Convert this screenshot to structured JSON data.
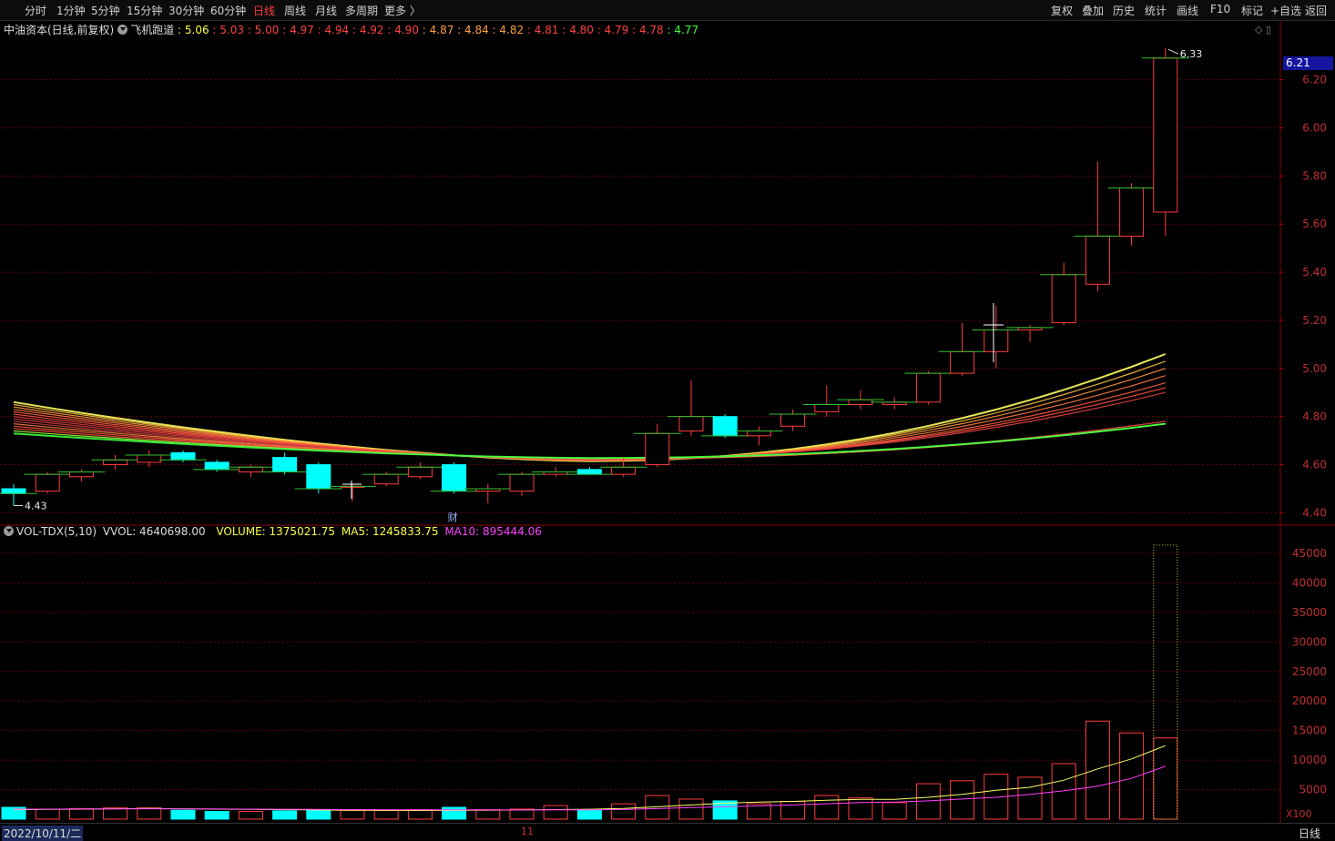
{
  "toolbar": {
    "periods": [
      "分时",
      "1分钟",
      "5分钟",
      "15分钟",
      "30分钟",
      "60分钟",
      "日线",
      "周线",
      "月线",
      "多周期",
      "更多 〉"
    ],
    "active_period": "日线",
    "right_tools": [
      "复权",
      "叠加",
      "历史",
      "统计",
      "画线",
      "F10",
      "标记",
      "+自选",
      "返回"
    ]
  },
  "legend": {
    "stock": "中油资本(日线,前复权)",
    "indicator": "飞机跑道",
    "values": [
      {
        "text": "5.06",
        "color": "#ffff40"
      },
      {
        "text": "5.03",
        "color": "#ff4040"
      },
      {
        "text": "5.00",
        "color": "#ff4040"
      },
      {
        "text": "4.97",
        "color": "#ff4040"
      },
      {
        "text": "4.94",
        "color": "#ff4040"
      },
      {
        "text": "4.92",
        "color": "#ff4040"
      },
      {
        "text": "4.90",
        "color": "#ff4040"
      },
      {
        "text": "4.87",
        "color": "#ffa040"
      },
      {
        "text": "4.84",
        "color": "#ffa040"
      },
      {
        "text": "4.82",
        "color": "#ffa040"
      },
      {
        "text": "4.81",
        "color": "#ff4040"
      },
      {
        "text": "4.80",
        "color": "#ff4040"
      },
      {
        "text": "4.79",
        "color": "#ff4040"
      },
      {
        "text": "4.78",
        "color": "#ff4040"
      },
      {
        "text": "4.77",
        "color": "#40ff40"
      }
    ]
  },
  "vol_legend": {
    "name": "VOL-TDX(5,10)",
    "vvol": "VVOL: 4640698.00",
    "volume": "VOLUME: 1375021.75",
    "ma5": "MA5: 1245833.75",
    "ma10": "MA10: 895444.06"
  },
  "current_price_tag": "6.21",
  "bottom": {
    "date": "2022/10/11/二",
    "period": "日线",
    "month_mark": "11"
  },
  "colors": {
    "up": "#ff3c3c",
    "down": "#00ffff",
    "grid": "#6a0000",
    "axis": "#8a0000",
    "ma5": "#ffff66",
    "ma10": "#ff40ff"
  },
  "chart_data": {
    "type": "candlestick",
    "price_axis": {
      "ticks": [
        "6.20",
        "6.00",
        "5.80",
        "5.60",
        "5.40",
        "5.20",
        "5.00",
        "4.80",
        "4.60",
        "4.40"
      ],
      "ylim": [
        4.36,
        6.38
      ]
    },
    "volume_axis": {
      "ticks": [
        "45000",
        "40000",
        "35000",
        "30000",
        "25000",
        "20000",
        "15000",
        "10000",
        "5000"
      ],
      "unit": "X100",
      "ylim": [
        0,
        47000
      ]
    },
    "annotations": {
      "high_label": "6.33",
      "low_label": "4.43",
      "event_marker": "财"
    },
    "candles": [
      {
        "o": 4.5,
        "h": 4.52,
        "l": 4.43,
        "c": 4.48,
        "v": 2000
      },
      {
        "o": 4.49,
        "h": 4.57,
        "l": 4.48,
        "c": 4.56,
        "v": 1700
      },
      {
        "o": 4.55,
        "h": 4.58,
        "l": 4.53,
        "c": 4.57,
        "v": 1800
      },
      {
        "o": 4.6,
        "h": 4.64,
        "l": 4.58,
        "c": 4.62,
        "v": 1900
      },
      {
        "o": 4.61,
        "h": 4.66,
        "l": 4.59,
        "c": 4.64,
        "v": 1900
      },
      {
        "o": 4.65,
        "h": 4.66,
        "l": 4.61,
        "c": 4.62,
        "v": 1500
      },
      {
        "o": 4.61,
        "h": 4.62,
        "l": 4.57,
        "c": 4.58,
        "v": 1300
      },
      {
        "o": 4.57,
        "h": 4.6,
        "l": 4.55,
        "c": 4.59,
        "v": 1300
      },
      {
        "o": 4.63,
        "h": 4.65,
        "l": 4.56,
        "c": 4.57,
        "v": 1400
      },
      {
        "o": 4.6,
        "h": 4.61,
        "l": 4.48,
        "c": 4.5,
        "v": 1500
      },
      {
        "o": 4.51,
        "h": 4.52,
        "l": 4.45,
        "c": 4.51,
        "v": 1500
      },
      {
        "o": 4.52,
        "h": 4.57,
        "l": 4.51,
        "c": 4.56,
        "v": 1500
      },
      {
        "o": 4.55,
        "h": 4.61,
        "l": 4.54,
        "c": 4.59,
        "v": 1600
      },
      {
        "o": 4.6,
        "h": 4.61,
        "l": 4.48,
        "c": 4.49,
        "v": 2000
      },
      {
        "o": 4.49,
        "h": 4.52,
        "l": 4.44,
        "c": 4.5,
        "v": 1600
      },
      {
        "o": 4.49,
        "h": 4.57,
        "l": 4.47,
        "c": 4.56,
        "v": 1700
      },
      {
        "o": 4.56,
        "h": 4.59,
        "l": 4.55,
        "c": 4.57,
        "v": 2300
      },
      {
        "o": 4.58,
        "h": 4.59,
        "l": 4.56,
        "c": 4.56,
        "v": 1500
      },
      {
        "o": 4.56,
        "h": 4.63,
        "l": 4.55,
        "c": 4.59,
        "v": 2600
      },
      {
        "o": 4.6,
        "h": 4.77,
        "l": 4.59,
        "c": 4.73,
        "v": 4000
      },
      {
        "o": 4.74,
        "h": 4.95,
        "l": 4.72,
        "c": 4.8,
        "v": 3400
      },
      {
        "o": 4.8,
        "h": 4.81,
        "l": 4.71,
        "c": 4.72,
        "v": 3100
      },
      {
        "o": 4.72,
        "h": 4.76,
        "l": 4.68,
        "c": 4.74,
        "v": 2600
      },
      {
        "o": 4.76,
        "h": 4.83,
        "l": 4.74,
        "c": 4.81,
        "v": 3000
      },
      {
        "o": 4.82,
        "h": 4.93,
        "l": 4.8,
        "c": 4.85,
        "v": 4000
      },
      {
        "o": 4.85,
        "h": 4.91,
        "l": 4.83,
        "c": 4.87,
        "v": 3600
      },
      {
        "o": 4.85,
        "h": 4.88,
        "l": 4.83,
        "c": 4.86,
        "v": 2800
      },
      {
        "o": 4.86,
        "h": 4.99,
        "l": 4.85,
        "c": 4.98,
        "v": 6000
      },
      {
        "o": 4.98,
        "h": 5.19,
        "l": 4.97,
        "c": 5.07,
        "v": 6500
      },
      {
        "o": 5.07,
        "h": 5.26,
        "l": 5.0,
        "c": 5.16,
        "v": 7600
      },
      {
        "o": 5.16,
        "h": 5.18,
        "l": 5.11,
        "c": 5.17,
        "v": 7100
      },
      {
        "o": 5.19,
        "h": 5.44,
        "l": 5.18,
        "c": 5.39,
        "v": 9400
      },
      {
        "o": 5.35,
        "h": 5.86,
        "l": 5.32,
        "c": 5.55,
        "v": 16600
      },
      {
        "o": 5.55,
        "h": 5.77,
        "l": 5.51,
        "c": 5.75,
        "v": 14600
      },
      {
        "o": 5.65,
        "h": 6.33,
        "l": 5.55,
        "c": 6.29,
        "v": 13750,
        "vv": 46400
      }
    ],
    "vol_ma5": [
      1600,
      1650,
      1700,
      1750,
      1800,
      1760,
      1700,
      1650,
      1600,
      1550,
      1500,
      1480,
      1470,
      1500,
      1520,
      1560,
      1620,
      1680,
      1800,
      2100,
      2400,
      2700,
      2900,
      3000,
      3200,
      3350,
      3350,
      3700,
      4200,
      4900,
      5400,
      6600,
      8500,
      10200,
      12458
    ],
    "vol_ma10": [
      1700,
      1700,
      1720,
      1730,
      1750,
      1740,
      1720,
      1700,
      1680,
      1650,
      1620,
      1600,
      1590,
      1580,
      1570,
      1560,
      1570,
      1590,
      1640,
      1780,
      1950,
      2100,
      2250,
      2400,
      2600,
      2800,
      2900,
      3100,
      3400,
      3700,
      4200,
      4800,
      5600,
      6900,
      8954
    ],
    "runway_bands": {
      "start_values": [
        4.86,
        4.85,
        4.84,
        4.83,
        4.82,
        4.81,
        4.8,
        4.79,
        4.78,
        4.77,
        4.76,
        4.75,
        4.74,
        4.73
      ],
      "end_values": [
        5.06,
        5.03,
        5.0,
        4.97,
        4.94,
        4.92,
        4.9,
        4.87,
        4.84,
        4.82,
        4.81,
        4.8,
        4.79,
        4.78,
        4.77
      ]
    }
  }
}
